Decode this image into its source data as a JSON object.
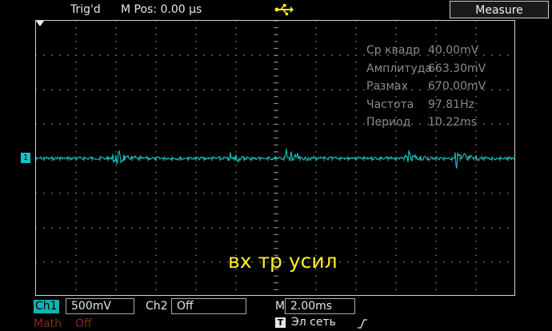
{
  "topbar": {
    "trig_status": "Trig'd",
    "m_pos": "M Pos: 0.00 µs",
    "measure_label": "Measure"
  },
  "measurements": [
    {
      "label": "Ср квадр",
      "value": "40.00mV"
    },
    {
      "label": "Амплитуда",
      "value": "663.30mV"
    },
    {
      "label": "Размах",
      "value": "670.00mV"
    },
    {
      "label": "Частота",
      "value": "97.81Hz"
    },
    {
      "label": "Период",
      "value": "10.22ms"
    }
  ],
  "caption": "вх тр усил",
  "channel_marker": "1",
  "trigger_marker_icon": "trigger-arrow-icon",
  "bottom": {
    "ch1_label": "Ch1",
    "ch1_scale": "500mV",
    "ch2_label": "Ch2",
    "ch2_value": "Off",
    "math_label": "Math",
    "math_value": "Off",
    "timebase_label": "M",
    "timebase_value": "2.00ms",
    "trigger_icon": "T",
    "trigger_source": "Эл сеть",
    "trigger_edge_icon": "rising-edge-icon"
  },
  "colors": {
    "trace": "#13c5c4",
    "caption": "#ffee2a",
    "grid": "#8c8c8c",
    "math": "#8a2a10"
  }
}
